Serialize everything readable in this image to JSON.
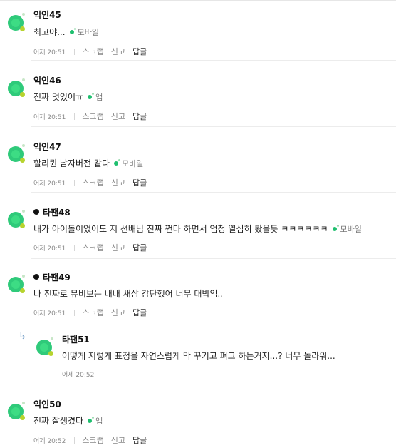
{
  "actions": {
    "scrap": "스크랩",
    "report": "신고",
    "reply": "답글"
  },
  "comments": [
    {
      "nick": "익인45",
      "text": "최고야...",
      "device": "모바일",
      "time": "어제 20:51"
    },
    {
      "nick": "익인46",
      "text": "진짜 멋있어ㅠ",
      "device": "앱",
      "time": "어제 20:51"
    },
    {
      "nick": "익인47",
      "text": "할리퀸 남자버전 같다",
      "device": "모바일",
      "time": "어제 20:51"
    },
    {
      "nick": "타팬48",
      "text": "내가 아이돌이었어도 저 선배님 진짜 쩐다 하면서 엄청 열심히 봤을듯 ㅋㅋㅋㅋㅋㅋ",
      "device": "모바일",
      "time": "어제 20:51"
    },
    {
      "nick": "타팬49",
      "text": "나 진짜로 뮤비보는 내내 새삼 감탄했어 너무 대박임..",
      "device": "",
      "time": "어제 20:51"
    },
    {
      "nick": "타팬51",
      "text": "어떻게 저렇게 표정을 자연스럽게 막 꾸기고 펴고 하는거지...? 너무 놀라워...",
      "device": "",
      "time": "어제 20:52"
    },
    {
      "nick": "익인50",
      "text": "진짜 잘생겼다",
      "device": "앱",
      "time": "어제 20:52"
    }
  ],
  "reply_icon": "reply-arrow-icon",
  "avatar_icon": "green-circle-avatar-icon",
  "colors": {
    "avatar": "#2fca7a",
    "device_dot": "#1fbf6f"
  }
}
